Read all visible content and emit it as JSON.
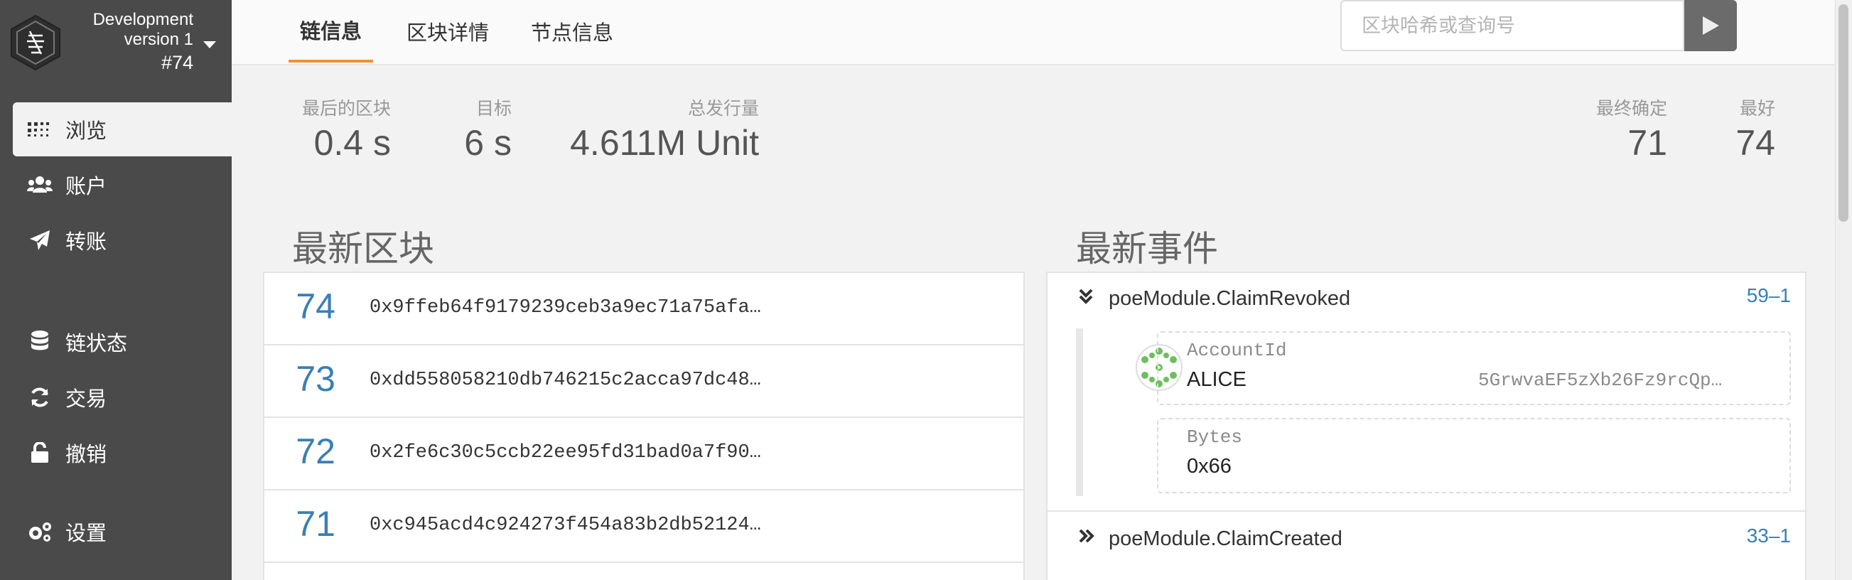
{
  "app": {
    "chain_name": "Development",
    "version": "version 1",
    "best_block_label": "#74"
  },
  "sidebar": {
    "items": [
      {
        "label": "浏览",
        "icon": "grid-dots-icon",
        "active": true
      },
      {
        "label": "账户",
        "icon": "users-icon"
      },
      {
        "label": "转账",
        "icon": "paper-plane-icon"
      },
      {
        "label": "链状态",
        "icon": "database-icon"
      },
      {
        "label": "交易",
        "icon": "sync-icon"
      },
      {
        "label": "撤销",
        "icon": "unlock-icon"
      },
      {
        "label": "设置",
        "icon": "cogs-icon"
      }
    ]
  },
  "tabs": [
    {
      "label": "链信息",
      "active": true
    },
    {
      "label": "区块详情"
    },
    {
      "label": "节点信息"
    }
  ],
  "search": {
    "placeholder": "区块哈希或查询号",
    "button_icon": "play-icon"
  },
  "stats": {
    "last_block": {
      "label": "最后的区块",
      "value": "0.4 s"
    },
    "target": {
      "label": "目标",
      "value": "6 s"
    },
    "total_issuance": {
      "label": "总发行量",
      "value": "4.611M Unit"
    },
    "finalized": {
      "label": "最终确定",
      "value": "71"
    },
    "best": {
      "label": "最好",
      "value": "74"
    }
  },
  "recent_blocks": {
    "title": "最新区块",
    "rows": [
      {
        "number": "74",
        "hash": "0x9ffeb64f9179239ceb3a9ec71a75afa…"
      },
      {
        "number": "73",
        "hash": "0xdd558058210db746215c2acca97dc48…"
      },
      {
        "number": "72",
        "hash": "0x2fe6c30c5ccb22ee95fd31bad0a7f90…"
      },
      {
        "number": "71",
        "hash": "0xc945acd4c924273f454a83b2db52124…"
      }
    ]
  },
  "recent_events": {
    "title": "最新事件",
    "events": [
      {
        "name": "poeModule.ClaimRevoked",
        "ref": "59–1",
        "expanded": true,
        "params": [
          {
            "type": "AccountId",
            "value": "ALICE",
            "address": "5GrwvaEF5zXb26Fz9rcQp…"
          },
          {
            "type": "Bytes",
            "value": "0x66"
          }
        ]
      },
      {
        "name": "poeModule.ClaimCreated",
        "ref": "33–1",
        "expanded": false
      }
    ]
  },
  "colors": {
    "sidebar_bg": "#4a4a4a",
    "accent_orange": "#f19135",
    "link_blue": "#3a7fb4"
  }
}
